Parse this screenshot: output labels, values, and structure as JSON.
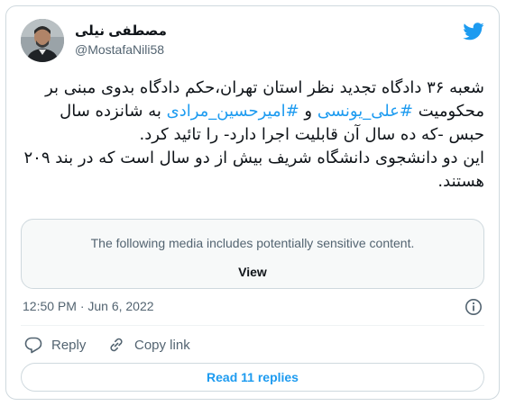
{
  "author": {
    "display_name": "مصطفی نیلی",
    "handle": "@MostafaNili58"
  },
  "tweet": {
    "p1_a": "شعبه ۳۶ دادگاه تجدید نظر استان تهران،حکم دادگاه بدوی مبنی بر محکومیت ",
    "hashtag1": "#علی_یونسی",
    "p1_b": " و ",
    "hashtag2": "#امیرحسین_مرادی",
    "p1_c": " به شانزده سال حبس -که ده سال آن قابلیت اجرا دارد- را تائید کرد.",
    "p2": "این دو دانشجوی دانشگاه شریف بیش از دو سال است که در بند ۲۰۹ هستند."
  },
  "media": {
    "warning": "The following media includes potentially sensitive content.",
    "view_label": "View"
  },
  "timestamp": "12:50 PM · Jun 6, 2022",
  "actions": {
    "reply": "Reply",
    "copy_link": "Copy link"
  },
  "read_replies": "Read 11 replies",
  "icons": {
    "brand": "twitter-bird-icon",
    "info": "info-icon",
    "reply": "reply-icon",
    "link": "link-icon"
  },
  "colors": {
    "brand": "#1d9bf0",
    "text": "#0f1419",
    "muted": "#536471",
    "border": "#cfd9de"
  }
}
